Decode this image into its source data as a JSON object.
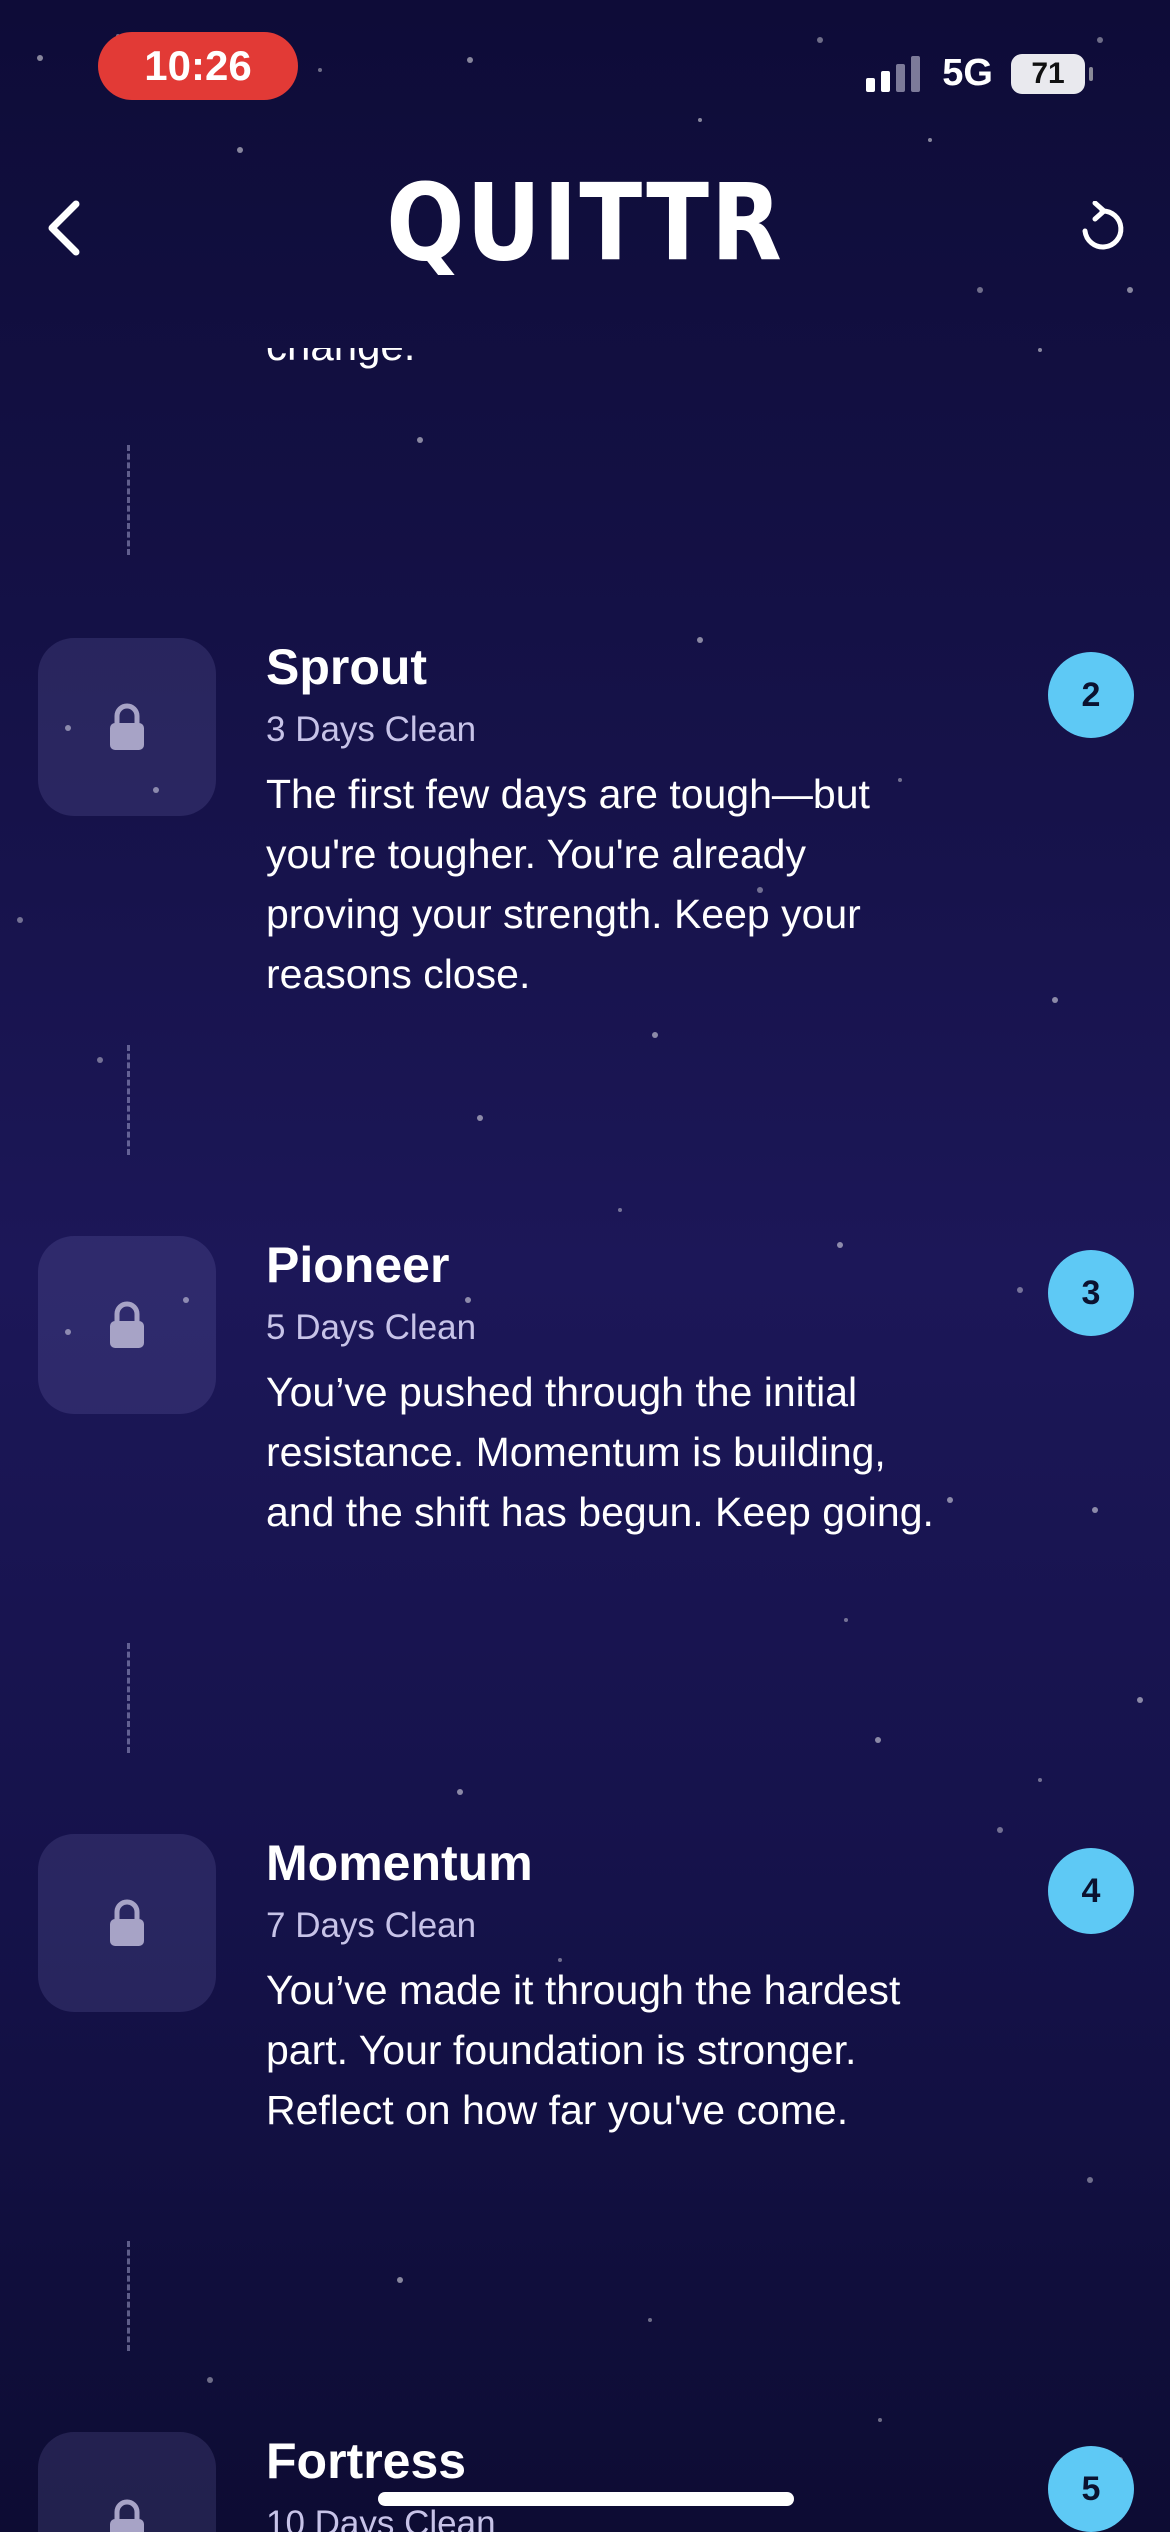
{
  "status_bar": {
    "time": "10:26",
    "network": "5G",
    "battery": "71",
    "time_pill_color": "#e23a36"
  },
  "header": {
    "logo": "QUITTR",
    "back_icon": "chevron-left-icon",
    "refresh_icon": "refresh-icon"
  },
  "clipped_previous_text": "change.",
  "milestones": [
    {
      "title": "Sprout",
      "subtitle": "3 Days Clean",
      "description": "The first few days are tough—but you're tougher. You're already proving your strength. Keep your reasons close.",
      "number": "2",
      "locked": true
    },
    {
      "title": "Pioneer",
      "subtitle": "5 Days Clean",
      "description": "You’ve pushed through the initial resistance. Momentum is building, and the shift has begun. Keep going.",
      "number": "3",
      "locked": true
    },
    {
      "title": "Momentum",
      "subtitle": "7 Days Clean",
      "description": "You’ve made it through the hardest part. Your foundation is stronger. Reflect on how far you've come.",
      "number": "4",
      "locked": true
    },
    {
      "title": "Fortress",
      "subtitle": "10 Days Clean",
      "description": "",
      "number": "5",
      "locked": true
    }
  ],
  "colors": {
    "badge": "#5ec9f5",
    "background_top": "#0e0c38",
    "background_mid": "#1c1758"
  }
}
